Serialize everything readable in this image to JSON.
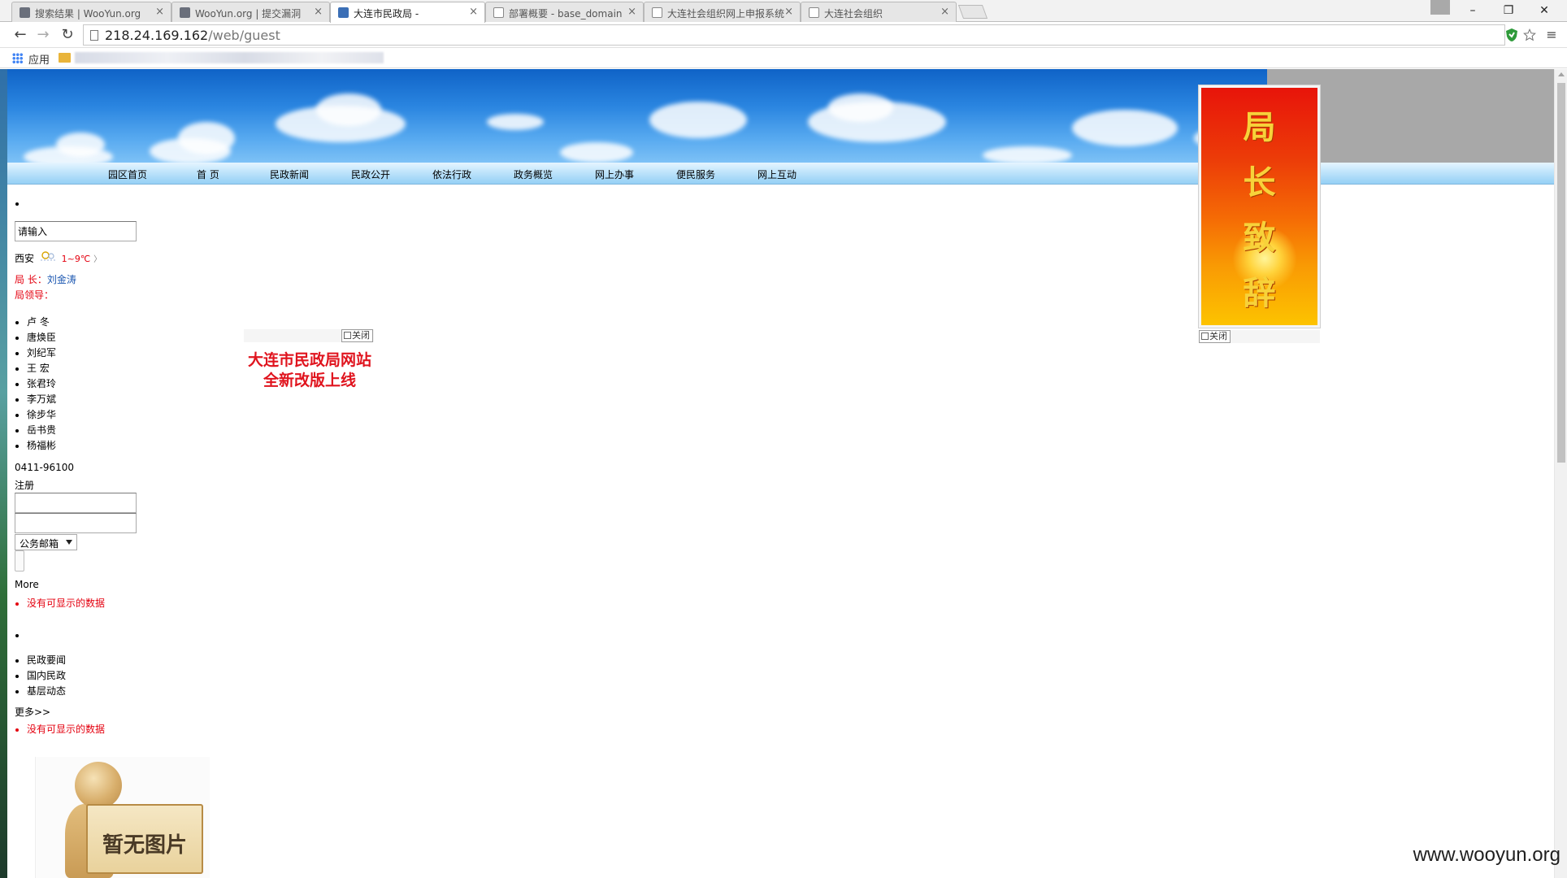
{
  "browser": {
    "tabs": [
      {
        "title": "搜索结果 | WooYun.org",
        "active": false
      },
      {
        "title": "WooYun.org | 提交漏洞",
        "active": false
      },
      {
        "title": "大连市民政局 -",
        "active": true
      },
      {
        "title": "部署概要 - base_domain",
        "active": false
      },
      {
        "title": "大连社会组织网上申报系统",
        "active": false
      },
      {
        "title": "大连社会组织",
        "active": false
      }
    ],
    "tab_close_glyph": "×",
    "url_host": "218.24.169.162",
    "url_path": "/web/guest",
    "window_controls": {
      "minimize": "–",
      "restore": "❐",
      "close": "✕"
    },
    "bookmarks": {
      "apps_label": "应用"
    }
  },
  "site": {
    "nav": [
      "园区首页",
      "首 页",
      "民政新闻",
      "民政公开",
      "依法行政",
      "政务概览",
      "网上办事",
      "便民服务",
      "网上互动"
    ],
    "search_value": "请输入",
    "weather": {
      "city": "西安",
      "temp": "1~9℃",
      "arrow": "〉"
    },
    "director": {
      "label": "局  长：",
      "name": "刘金涛"
    },
    "leaders_label": "局领导：",
    "leaders": [
      "卢  冬",
      "唐焕臣",
      "刘纪军",
      "王  宏",
      "张君玲",
      "李万斌",
      "徐步华",
      "岳书贵",
      "杨福彬"
    ],
    "phone": "0411-96100",
    "register_label": "注册",
    "mailbox_select": "公务邮箱",
    "more_label": "More",
    "no_data_1": "没有可显示的数据",
    "news_tabs": [
      "民政要闻",
      "国内民政",
      "基层动态"
    ],
    "more_cn": "更多>>",
    "no_data_2": "没有可显示的数据",
    "float_ad": {
      "close": "关闭",
      "line1": "大连市民政局网站",
      "line2": "全新改版上线"
    },
    "director_panel": {
      "chars": [
        "局",
        "长",
        "致",
        "辞"
      ],
      "close": "关闭"
    },
    "no_image_text": "暂无图片"
  },
  "watermark": "www.wooyun.org"
}
